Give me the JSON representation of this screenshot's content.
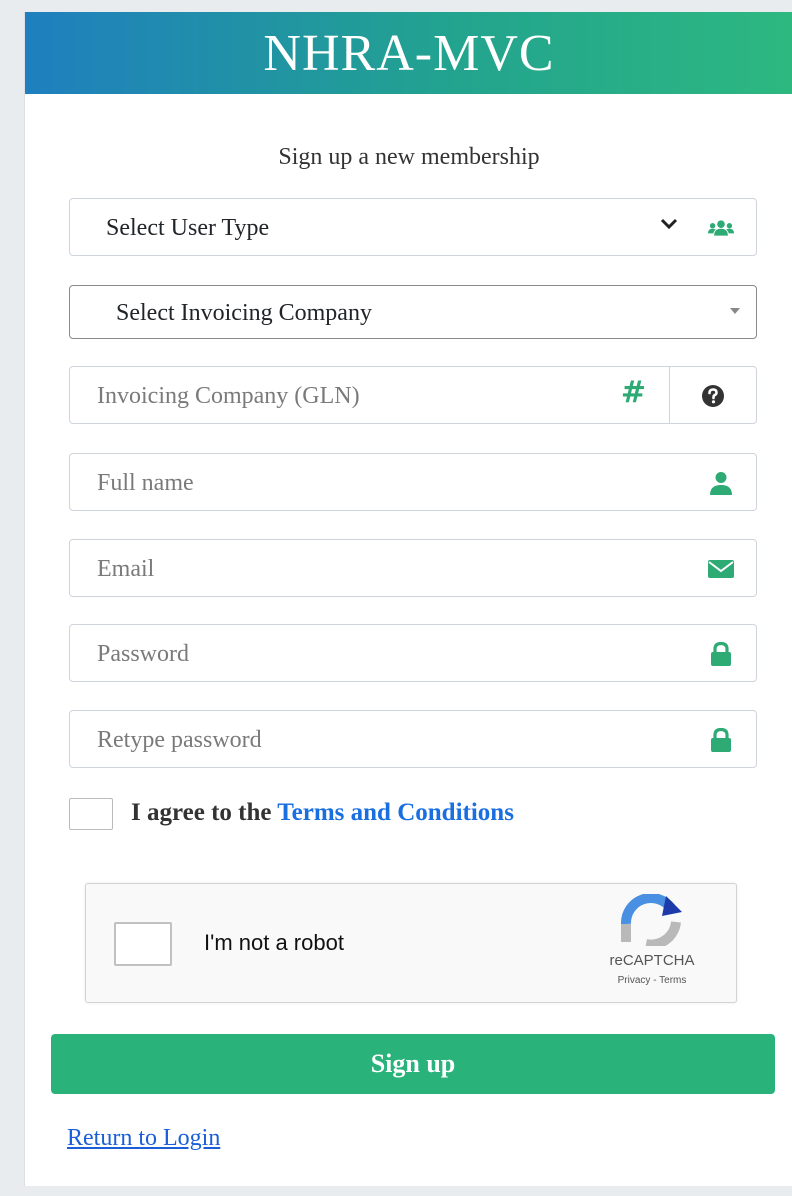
{
  "header": {
    "title": "NHRA-MVC",
    "color_start": "#1f7fbf",
    "color_end": "#2db880"
  },
  "subtitle": "Sign up a new membership",
  "form": {
    "user_type": {
      "value": "Select User Type",
      "icon": "users-icon"
    },
    "invoicing_company": {
      "value": "Select Invoicing Company"
    },
    "gln": {
      "placeholder": "Invoicing Company (GLN)",
      "icon": "hash-icon",
      "help_icon": "question-circle-icon"
    },
    "full_name": {
      "placeholder": "Full name",
      "icon": "user-icon"
    },
    "email": {
      "placeholder": "Email",
      "icon": "envelope-icon"
    },
    "password": {
      "placeholder": "Password",
      "icon": "lock-icon"
    },
    "retype_password": {
      "placeholder": "Retype password",
      "icon": "lock-icon"
    },
    "agree": {
      "prefix": "I agree to the",
      "link": "Terms and Conditions"
    }
  },
  "recaptcha": {
    "label": "I'm not a robot",
    "brand": "reCAPTCHA",
    "links": "Privacy - Terms"
  },
  "signup_button": "Sign up",
  "return_link": "Return to Login",
  "accent_color": "#2ab27b",
  "link_color": "#1a6fe0"
}
